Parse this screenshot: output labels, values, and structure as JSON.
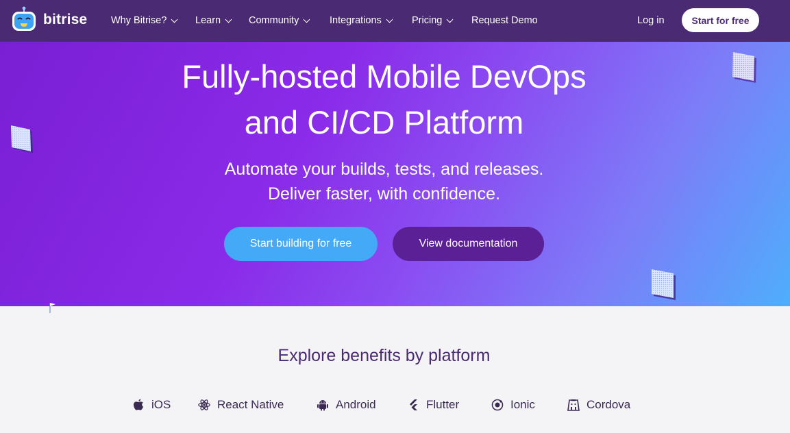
{
  "brand": {
    "name": "bitrise"
  },
  "nav": {
    "items": [
      {
        "label": "Why Bitrise?",
        "has_dropdown": true
      },
      {
        "label": "Learn",
        "has_dropdown": true
      },
      {
        "label": "Community",
        "has_dropdown": true
      },
      {
        "label": "Integrations",
        "has_dropdown": true
      },
      {
        "label": "Pricing",
        "has_dropdown": true
      },
      {
        "label": "Request Demo",
        "has_dropdown": false
      }
    ],
    "login_label": "Log in",
    "cta_label": "Start for free"
  },
  "hero": {
    "title_line1": "Fully-hosted Mobile DevOps",
    "title_line2": "and CI/CD Platform",
    "subtitle_line1": "Automate your builds, tests, and releases.",
    "subtitle_line2": "Deliver faster, with confidence.",
    "primary_cta": "Start building for free",
    "secondary_cta": "View documentation"
  },
  "benefits": {
    "title": "Explore benefits by platform",
    "platforms": [
      {
        "label": "iOS",
        "icon": "apple-icon"
      },
      {
        "label": "React Native",
        "icon": "react-icon"
      },
      {
        "label": "Android",
        "icon": "android-icon"
      },
      {
        "label": "Flutter",
        "icon": "flutter-icon"
      },
      {
        "label": "Ionic",
        "icon": "ionic-icon"
      },
      {
        "label": "Cordova",
        "icon": "cordova-icon"
      }
    ]
  },
  "colors": {
    "nav_bg": "#4a2a72",
    "hero_gradient_start": "#7a1fd4",
    "hero_gradient_end": "#4eaefc",
    "primary_button": "#44a9f6",
    "secondary_button": "#5b1f96",
    "page_bg": "#f4f4f6"
  }
}
